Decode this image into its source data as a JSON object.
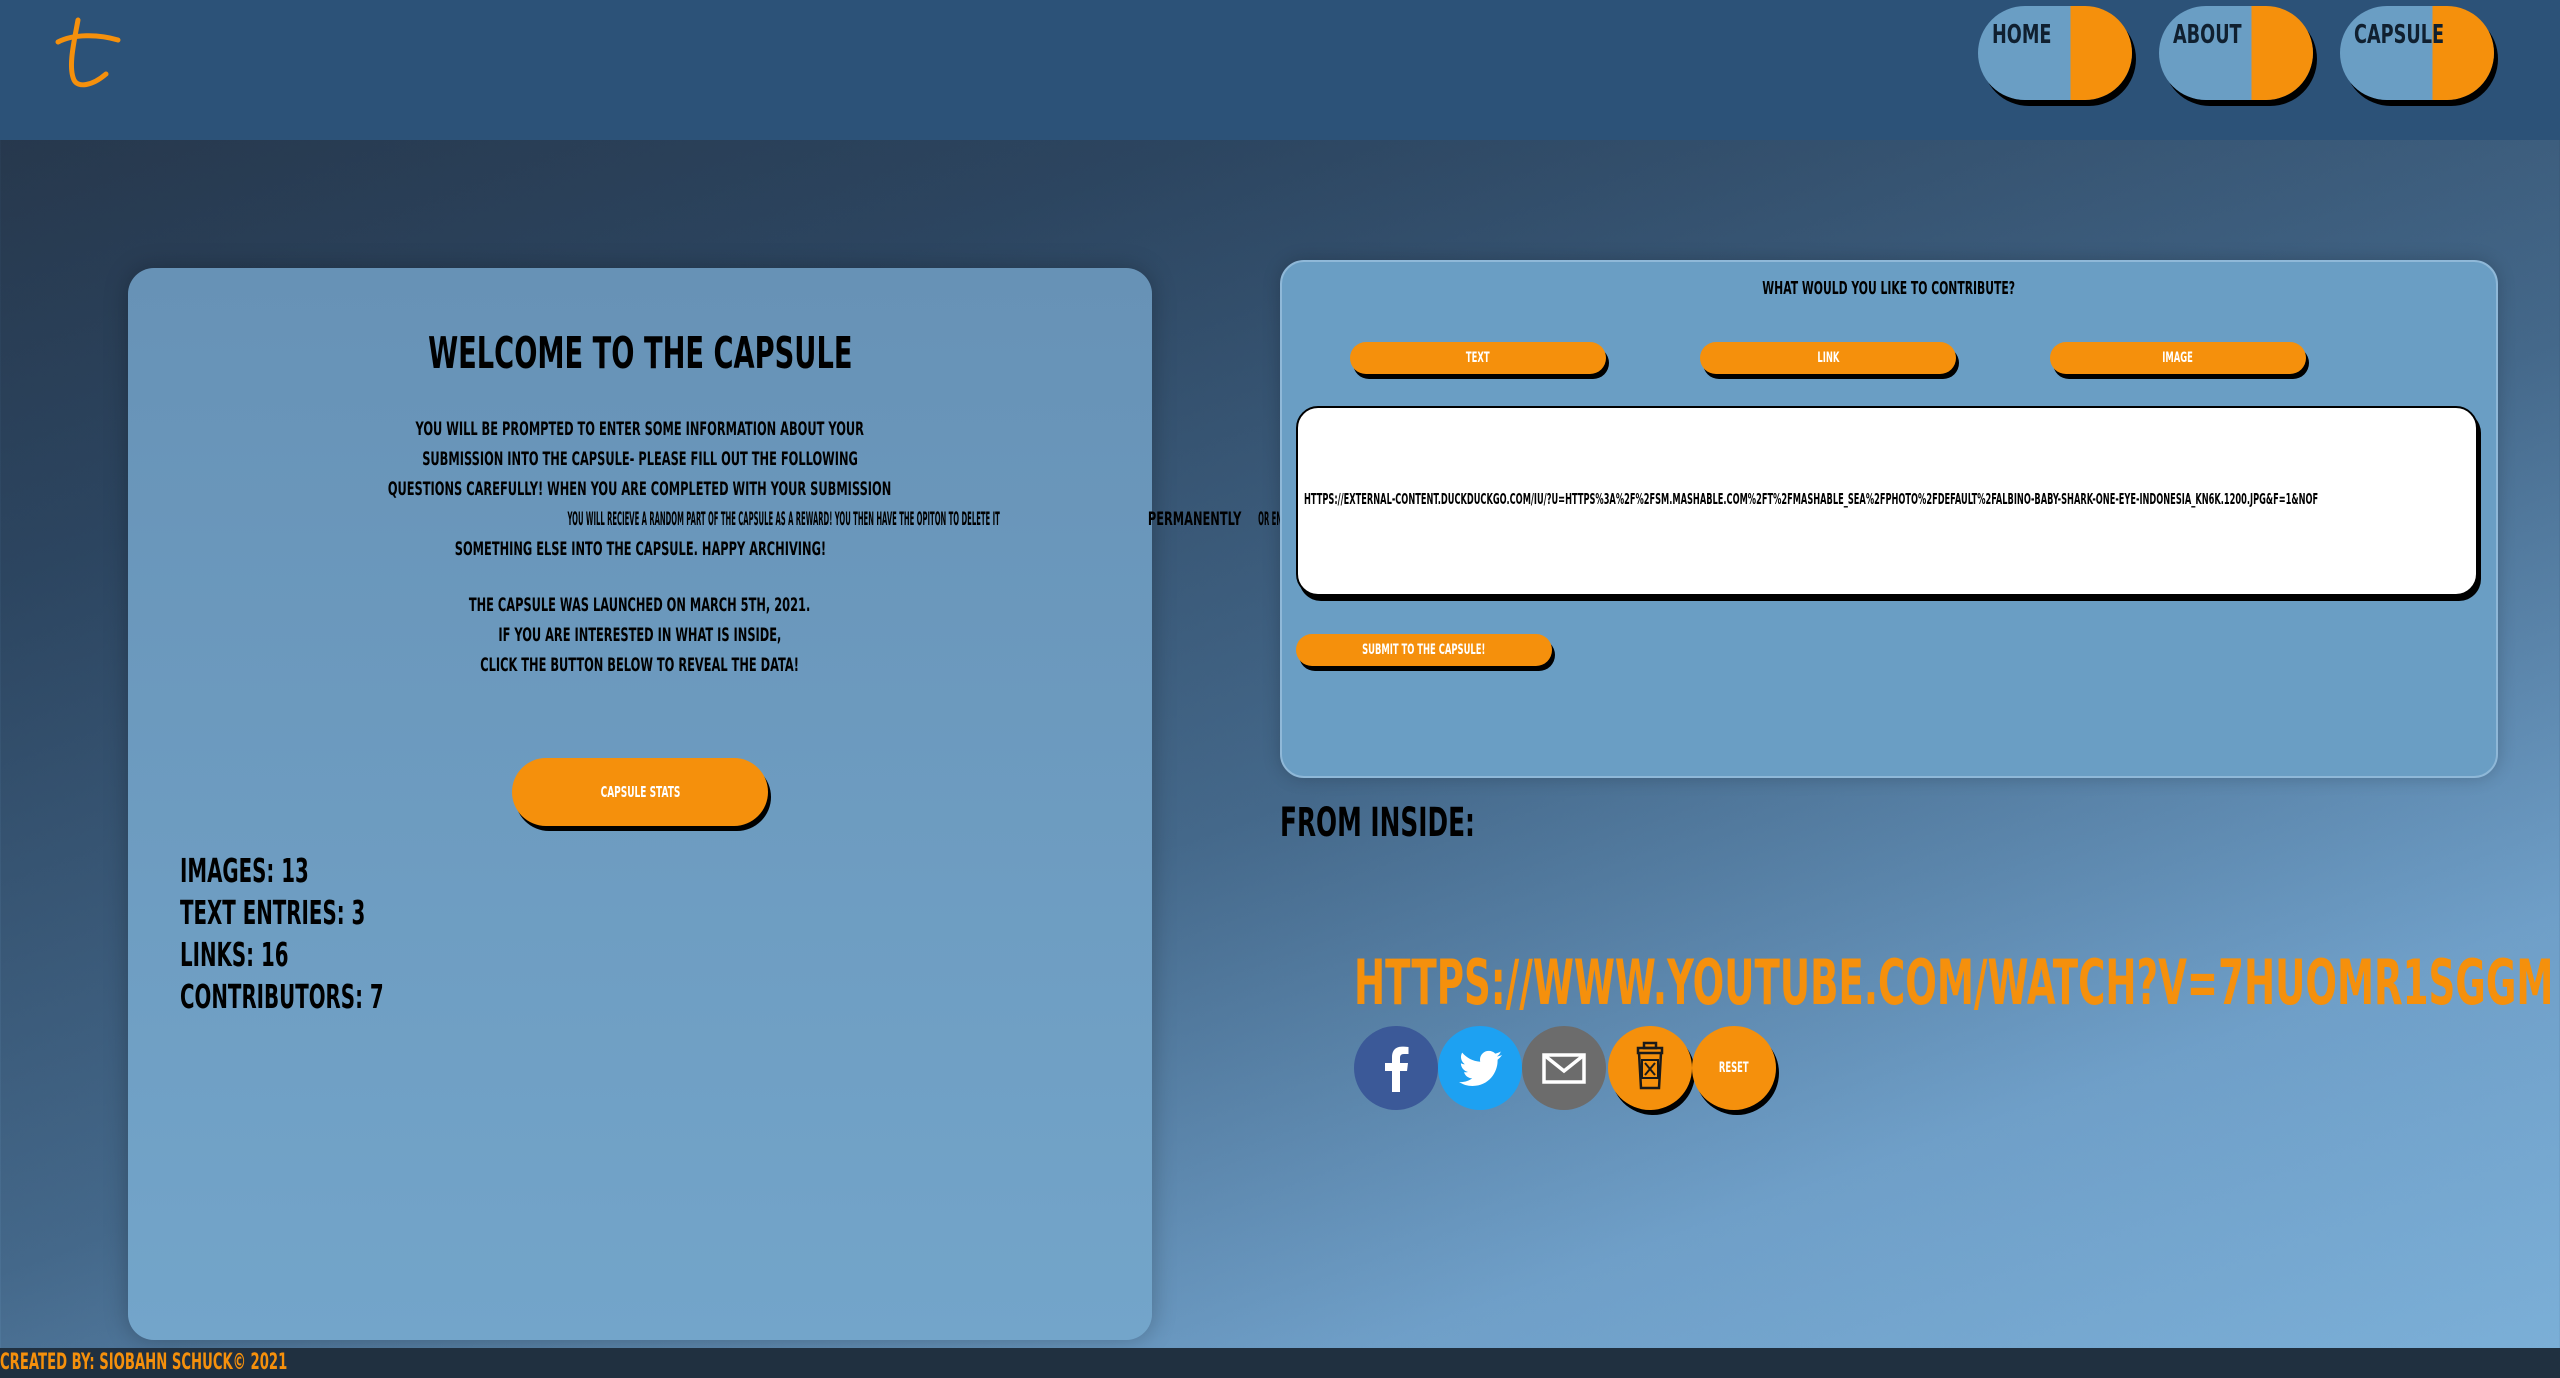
{
  "header": {
    "logo_glyph": "t",
    "nav": [
      {
        "label": "HOME"
      },
      {
        "label": "ABOUT"
      },
      {
        "label": "CAPSULE"
      }
    ]
  },
  "welcome": {
    "title": "WELCOME TO THE CAPSULE",
    "intro_lines": [
      "YOU WILL BE PROMPTED TO ENTER SOME INFORMATION ABOUT YOUR",
      "SUBMISSION INTO THE CAPSULE- PLEASE FILL OUT THE FOLLOWING",
      "QUESTIONS CAREFULLY! WHEN YOU ARE COMPLETED WITH YOUR SUBMISSION",
      "YOU WILL RECIEVE A RANDOM PART OF THE CAPSULE AS A REWARD! YOU THEN HAVE THE OPITON TO DELETE IT",
      "SOMETHING ELSE INTO THE CAPSULE. HAPPY ARCHIVING!"
    ],
    "intro_emphasis": "PERMANENTLY",
    "intro_line4_tail": "OR ENTER",
    "launch_lines": [
      "THE CAPSULE WAS LAUNCHED ON MARCH 5TH, 2021.",
      "IF YOU ARE INTERESTED IN WHAT IS INSIDE,",
      "CLICK THE BUTTON BELOW TO REVEAL THE DATA!"
    ],
    "stats_button": "CAPSULE STATS",
    "stats": [
      "IMAGES: 13",
      "TEXT ENTRIES: 3",
      "LINKS: 16",
      "CONTRIBUTORS: 7"
    ]
  },
  "contribute": {
    "question": "WHAT WOULD YOU LIKE TO CONTRIBUTE?",
    "options": [
      "TEXT",
      "LINK",
      "IMAGE"
    ],
    "input_value": "HTTPS://EXTERNAL-CONTENT.DUCKDUCKGO.COM/IU/?U=HTTPS%3A%2F%2FSM.MASHABLE.COM%2FT%2FMASHABLE_SEA%2FPHOTO%2FDEFAULT%2FALBINO-BABY-SHARK-ONE-EYE-INDONESIA_KN6K.1200.JPG&F=1&NOF",
    "submit_label": "SUBMIT TO THE CAPSULE!"
  },
  "inside": {
    "heading": "FROM INSIDE:",
    "link_text": "HTTPS://WWW.YOUTUBE.COM/WATCH?V=7HUOMR1SGGM",
    "actions": {
      "facebook_icon": "facebook-icon",
      "twitter_icon": "twitter-icon",
      "email_icon": "email-icon",
      "trash_icon": "trash-icon",
      "reset_label": "RESET"
    }
  },
  "footer": {
    "credit": "CREATED BY: SIOBAHN SCHUCK© 2021"
  },
  "colors": {
    "accent": "#f5900c",
    "header": "#2c5278",
    "panel": "#6a9ec4",
    "facebook": "#3b5998",
    "twitter": "#1da1f2",
    "email": "#6c6c6c"
  }
}
